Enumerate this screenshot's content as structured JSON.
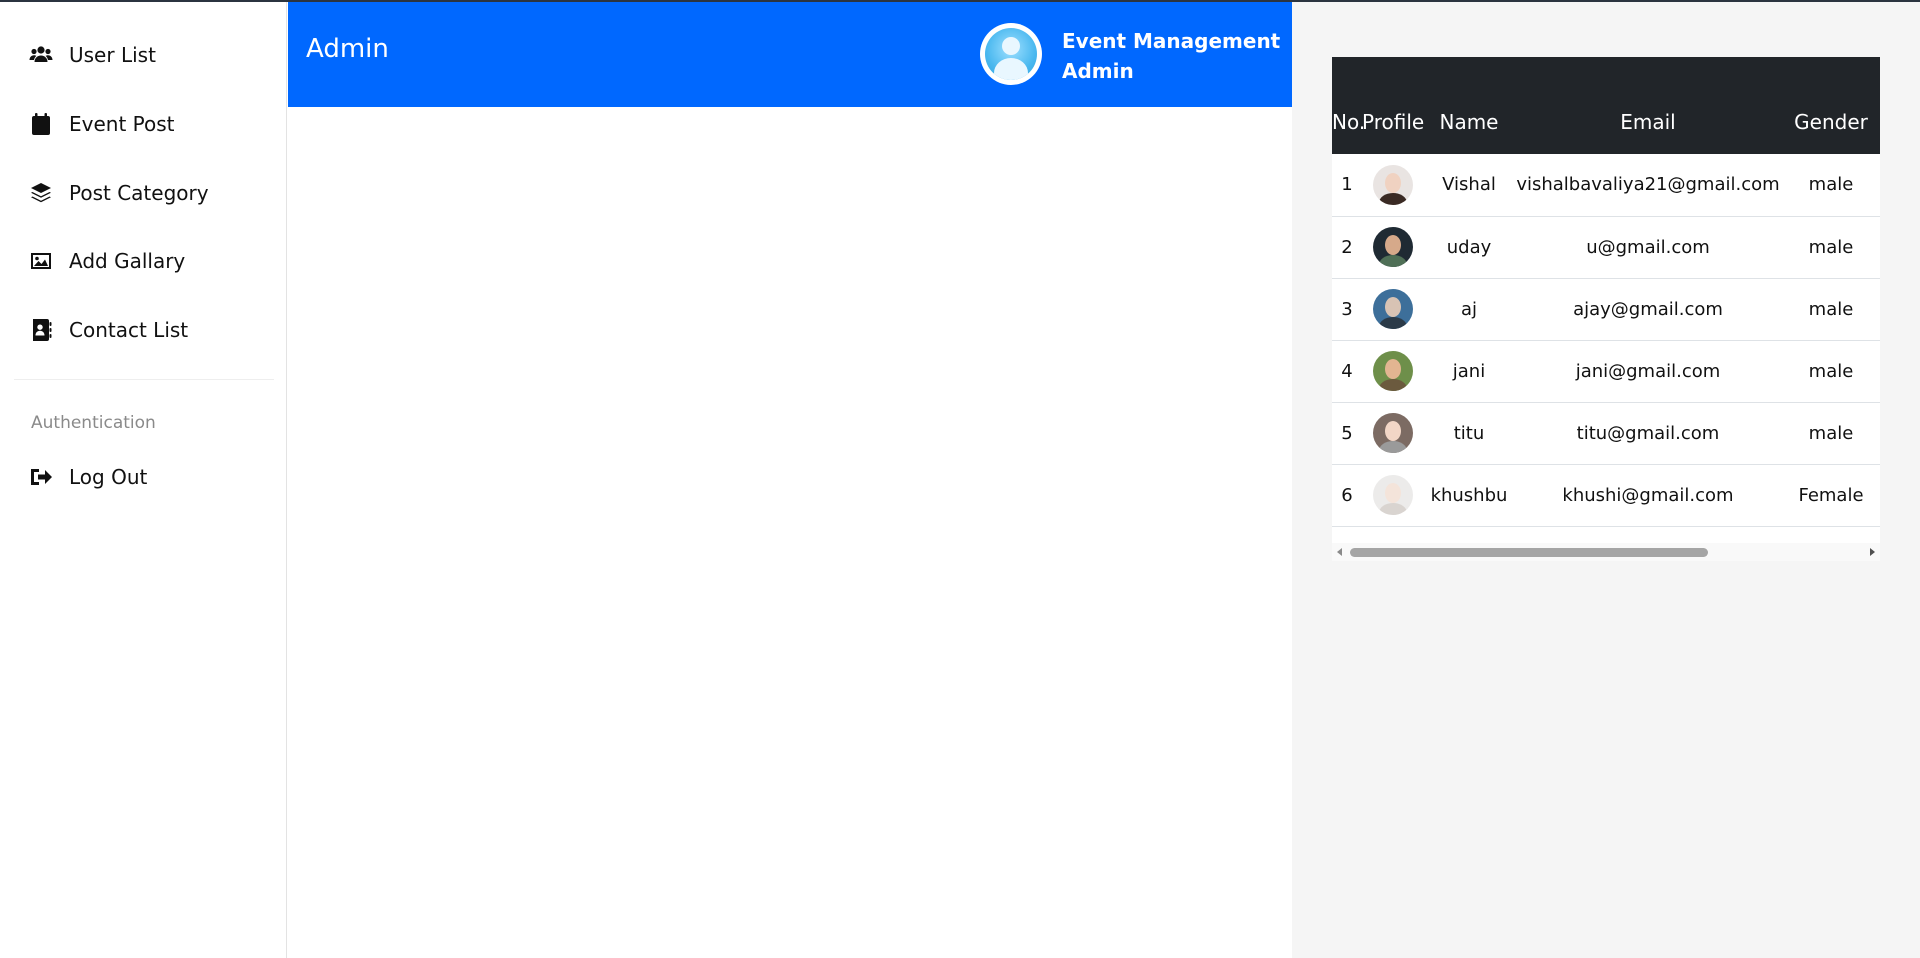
{
  "sidebar": {
    "items": [
      {
        "label": "User List",
        "icon": "users-icon"
      },
      {
        "label": "Event Post",
        "icon": "calendar-icon"
      },
      {
        "label": "Post Category",
        "icon": "layers-icon"
      },
      {
        "label": "Add Gallary",
        "icon": "image-icon"
      },
      {
        "label": "Contact List",
        "icon": "address-book-icon"
      }
    ],
    "section_label": "Authentication",
    "logout": {
      "label": "Log Out",
      "icon": "sign-out-icon"
    }
  },
  "header": {
    "title": "Admin",
    "user_line1": "Event Management",
    "user_line2": "Admin",
    "color": "#0068ff"
  },
  "table": {
    "columns": [
      "No.",
      "Profile",
      "Name",
      "Email",
      "Gender"
    ],
    "rows": [
      {
        "no": "1",
        "name": "Vishal",
        "email": "vishalbavaliya21@gmail.com",
        "gender": "male"
      },
      {
        "no": "2",
        "name": "uday",
        "email": "u@gmail.com",
        "gender": "male"
      },
      {
        "no": "3",
        "name": "aj",
        "email": "ajay@gmail.com",
        "gender": "male"
      },
      {
        "no": "4",
        "name": "jani",
        "email": "jani@gmail.com",
        "gender": "male"
      },
      {
        "no": "5",
        "name": "titu",
        "email": "titu@gmail.com",
        "gender": "male"
      },
      {
        "no": "6",
        "name": "khushbu",
        "email": "khushi@gmail.com",
        "gender": "Female"
      }
    ],
    "header_bg": "#212529"
  }
}
